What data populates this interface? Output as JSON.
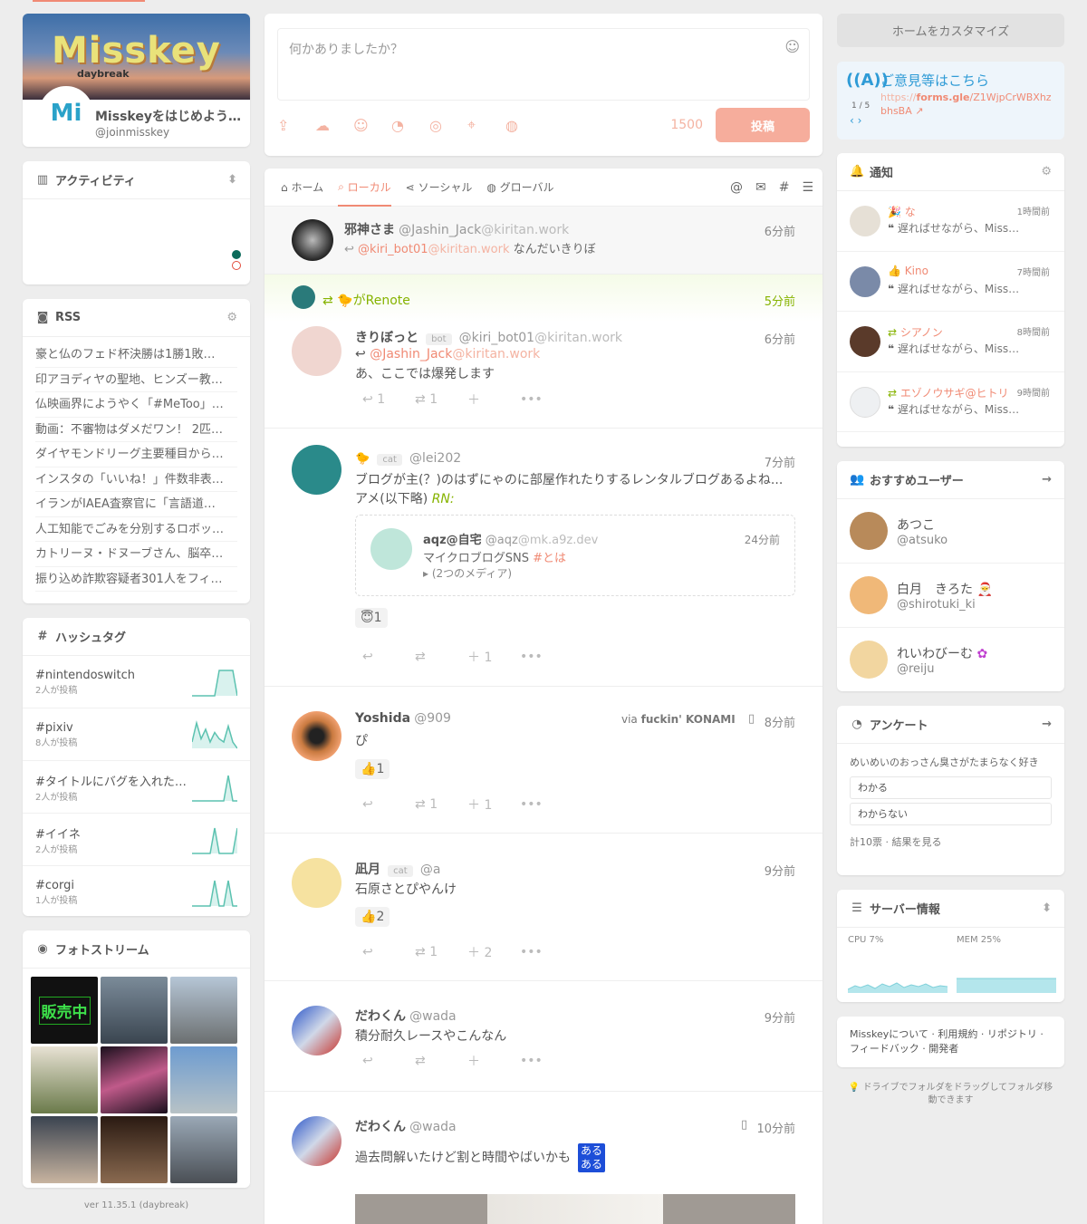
{
  "profile": {
    "name": "Misskeyをはじめよう…",
    "acct": "@joinmisskey",
    "banner_logo": "Misskey",
    "banner_sub": "daybreak",
    "avatar_text": "Mi"
  },
  "activity": {
    "title": "アクティビティ"
  },
  "rss": {
    "title": "RSS",
    "items": [
      "豪と仏のフェド杯決勝は1勝1敗…",
      "印アヨディヤの聖地、ヒンズー教…",
      "仏映画界にようやく「#MeToo」…",
      "動画：不審物はダメだワン！ 2匹…",
      "ダイヤモンドリーグ主要種目から…",
      "インスタの「いいね！」件数非表…",
      "イランがIAEA査察官に「言語道…",
      "人工知能でごみを分別するロボッ…",
      "カトリーヌ・ドヌーブさん、脳卒…",
      "振り込め詐欺容疑者301人をフィ…"
    ]
  },
  "hashtags": {
    "title": "ハッシュタグ",
    "items": [
      {
        "tag": "#nintendoswitch",
        "count": "2人が投稿",
        "chart": [
          0,
          0,
          0,
          0,
          0,
          0,
          8,
          8,
          8,
          8,
          0
        ]
      },
      {
        "tag": "#pixiv",
        "count": "8人が投稿",
        "chart": [
          2,
          8,
          3,
          6,
          2,
          5,
          3,
          2,
          7,
          2,
          0
        ]
      },
      {
        "tag": "#タイトルにバグを入れた…",
        "count": "2人が投稿",
        "chart": [
          0,
          0,
          0,
          0,
          0,
          0,
          0,
          0,
          8,
          0,
          0
        ]
      },
      {
        "tag": "#イイネ",
        "count": "2人が投稿",
        "chart": [
          0,
          0,
          0,
          0,
          0,
          8,
          0,
          0,
          0,
          0,
          8
        ]
      },
      {
        "tag": "#corgi",
        "count": "1人が投稿",
        "chart": [
          0,
          0,
          0,
          0,
          0,
          8,
          0,
          0,
          8,
          0,
          0
        ]
      }
    ]
  },
  "photos": {
    "title": "フォトストリーム",
    "sign": "販売中"
  },
  "version": "ver 11.35.1 (daybreak)",
  "postform": {
    "placeholder": "何かありましたか？",
    "count": "1500",
    "submit": "投稿"
  },
  "tabs": [
    "ホーム",
    "ローカル",
    "ソーシャル",
    "グローバル"
  ],
  "notes": [
    {
      "name": "邪神さま",
      "handle": "@Jashin_Jack",
      "host": "@kiritan.work",
      "time": "6分前",
      "reply_to": "@kiri_bot01",
      "reply_host": "@kiritan.work",
      "text": "なんだいきりぼ"
    },
    {
      "renote_by": "がRenote",
      "renote_time": "5分前",
      "name": "きりぼっと",
      "badge": "bot",
      "handle": "@kiri_bot01",
      "host": "@kiritan.work",
      "time": "6分前",
      "reply_to": "@Jashin_Jack",
      "reply_host": "@kiritan.work",
      "text": "あ、ここでは爆発します",
      "replies": "1",
      "renotes": "1"
    },
    {
      "name": "",
      "badge": "cat",
      "handle": "@lei202",
      "time": "7分前",
      "text": "ブログが主(？)のはずにゃのに部屋作れたりするレンタルブログあるよね...アメ(以下略)",
      "rn": "RN:",
      "quote": {
        "name": "aqz@自宅",
        "handle": "@aqz",
        "host": "@mk.a9z.dev",
        "time": "24分前",
        "text": "マイクロブログSNS",
        "tag": "#とは",
        "media": "▸ (2つのメディア)"
      },
      "reaction": "1",
      "reactcount": "1"
    },
    {
      "name": "Yoshida",
      "handle": "@909",
      "via_label": "via",
      "via": "fuckin' KONAMI",
      "time": "8分前",
      "text": "ぴ",
      "reaction": "1",
      "renotes": "1",
      "reactcount": "1"
    },
    {
      "name": "凪月",
      "badge": "cat",
      "handle": "@a",
      "time": "9分前",
      "text": "石原さとぴやんけ",
      "reaction": "2",
      "renotes": "1",
      "reactcount": "2"
    },
    {
      "name": "だわくん",
      "handle": "@wada",
      "time": "9分前",
      "text": "積分耐久レースやこんなん"
    },
    {
      "name": "だわくん",
      "handle": "@wada",
      "time": "10分前",
      "text": "過去問解いたけど割と時間やばいかも",
      "emoji_top": "ある",
      "emoji_bottom": "ある"
    }
  ],
  "right": {
    "customize": "ホームをカスタマイズ",
    "feedback": {
      "title": "ご意見等はこちら",
      "url_prefix": "https://",
      "url_host": "forms.gle",
      "url_path": "/Z1WjpCrWBXhzbhsBA",
      "page": "1 / 5"
    },
    "notifications": {
      "title": "通知",
      "items": [
        {
          "name": "な",
          "text": "遅ればせながら、Misskeyを…",
          "time": "1時間前"
        },
        {
          "name": "Kino",
          "text": "遅ればせながら、Misskeyを…",
          "time": "7時間前"
        },
        {
          "name": "シアノン",
          "text": "遅ればせながら、Misskeyを…",
          "time": "8時間前"
        },
        {
          "name": "エゾノウサギ@ヒトリ",
          "text": "遅ればせながら、Misskeyを…",
          "time": "9時間前"
        }
      ]
    },
    "recommended": {
      "title": "おすすめユーザー",
      "items": [
        {
          "name": "あつこ",
          "handle": "@atsuko"
        },
        {
          "name": "白月　きろた",
          "handle": "@shirotuki_ki"
        },
        {
          "name": "れいわびーむ",
          "handle": "@reiju"
        }
      ]
    },
    "poll": {
      "title": "アンケート",
      "question": "めいめいのおっさん臭さがたまらなく好き",
      "options": [
        "わかる",
        "わからない"
      ],
      "footer": "計10票 · 結果を見る"
    },
    "server": {
      "title": "サーバー情報",
      "cpu": "CPU 7%",
      "mem": "MEM 25%"
    },
    "links": "Misskeyについて · 利用規約 · リポジトリ · フィードバック · 開発者",
    "tip": "ドライブでフォルダをドラッグしてフォルダ移動できます"
  },
  "colors": {
    "accent": "#f08a74",
    "renote": "#86b300",
    "link": "#2f9bd6"
  }
}
